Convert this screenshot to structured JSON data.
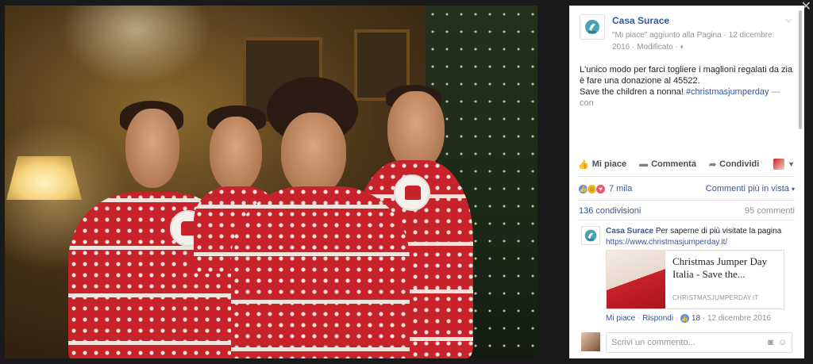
{
  "close": {
    "icon": "close-icon",
    "glyph": "✕"
  },
  "post": {
    "page_name": "Casa Surace",
    "meta_line": "\"Mi piace\" aggiunto alla Pagina · 12 dicembre 2016 · Modificato ·",
    "text_main": "L'unico modo per farci togliere i maglioni regalati da zia è fare una donazione al 45522.",
    "text_line2": "Save the children a nonna! ",
    "hashtag": "#christmasjumperday",
    "more": " — con"
  },
  "actions": {
    "like": "Mi piace",
    "comment": "Commenta",
    "share": "Condividi"
  },
  "reactions": {
    "count": "7 mila",
    "top_comments": "Commenti più in vista",
    "shares": "136 condivisioni",
    "comments": "95 commenti"
  },
  "comment": {
    "author": "Casa Surace",
    "text": " Per saperne di più visitate la pagina",
    "link": "https://www.christmasjumperday.it/",
    "card_title": "Christmas Jumper Day Italia - Save the...",
    "card_domain": "CHRISTMASJUMPERDAY.IT",
    "like": "Mi piace",
    "reply": "Rispondi",
    "likes": "18",
    "date": "12 dicembre 2016"
  },
  "composer": {
    "placeholder": "Scrivi un commento..."
  }
}
